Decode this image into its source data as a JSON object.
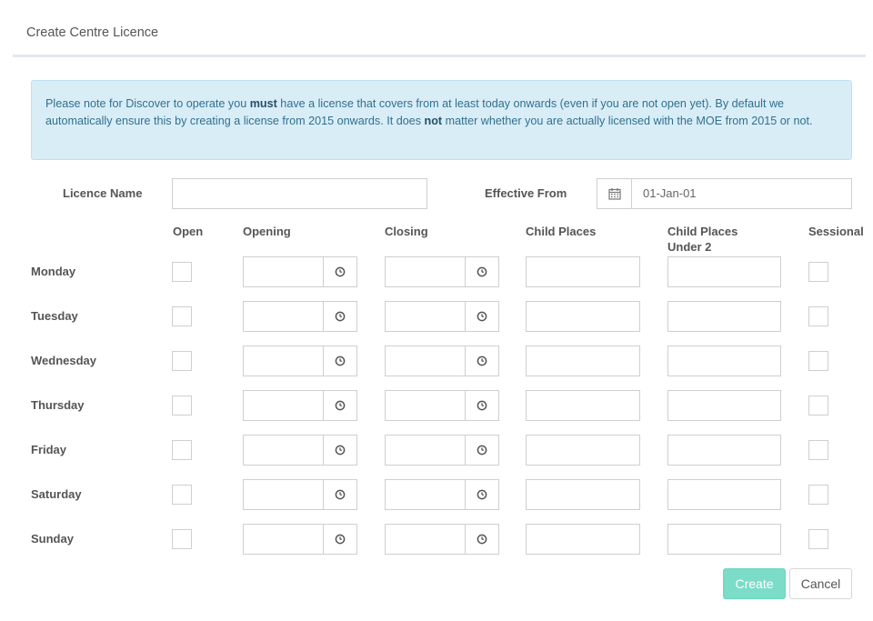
{
  "modal": {
    "title": "Create Centre Licence"
  },
  "alert": {
    "part1": "Please note for Discover to operate you ",
    "bold1": "must",
    "part2": " have a license that covers from at least today onwards (even if you are not open yet). By default we automatically ensure this by creating a license from 2015 onwards. It does ",
    "bold2": "not",
    "part3": " matter whether you are actually licensed with the MOE from 2015 or not."
  },
  "form": {
    "licence_name_label": "Licence Name",
    "licence_name_value": "",
    "effective_from_label": "Effective From",
    "effective_from_value": "01-Jan-01"
  },
  "columns": {
    "open": "Open",
    "opening": "Opening",
    "closing": "Closing",
    "child_places": "Child Places",
    "child_places_under2": "Child Places Under 2",
    "sessional": "Sessional"
  },
  "days": [
    {
      "label": "Monday"
    },
    {
      "label": "Tuesday"
    },
    {
      "label": "Wednesday"
    },
    {
      "label": "Thursday"
    },
    {
      "label": "Friday"
    },
    {
      "label": "Saturday"
    },
    {
      "label": "Sunday"
    }
  ],
  "buttons": {
    "create": "Create",
    "cancel": "Cancel"
  },
  "colors": {
    "alert_bg": "#d9edf7",
    "alert_text": "#31708f",
    "primary": "#7bdcc8"
  },
  "icons": {
    "date": "calendar-icon",
    "time": "clock-icon"
  }
}
